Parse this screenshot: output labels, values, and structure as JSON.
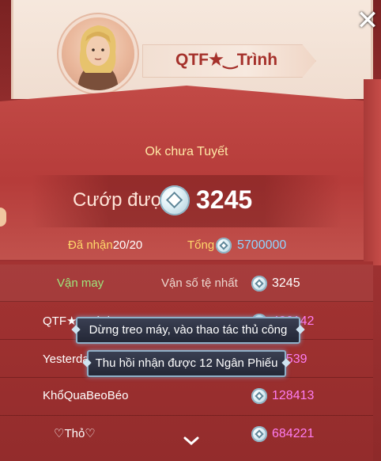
{
  "player": {
    "name": "QTF★‿Trình"
  },
  "message": "Ok chưa Tuyết",
  "loot": {
    "label": "Cướp được",
    "value": "3245"
  },
  "stats": {
    "received_label": "Đã nhận",
    "received_value": "20/20",
    "total_label": "Tổng",
    "total_value": "5700000"
  },
  "list": {
    "header": {
      "luck_label": "Vận may",
      "worst_label": "Vận số tệ nhất",
      "worst_value": "3245"
    },
    "rows": [
      {
        "name": "QTF★‿Trình",
        "value": "426142"
      },
      {
        "name": "Yesterday",
        "value": "77539"
      },
      {
        "name": "KhổQuaBeoBéo",
        "value": "128413"
      },
      {
        "name": "♡Thỏ♡",
        "value": "684221"
      }
    ]
  },
  "toasts": [
    "Dừng treo máy, vào thao tác thủ công",
    "Thu hồi nhận được 12 Ngân Phiếu"
  ],
  "icons": {
    "close": "close-icon",
    "coin": "silver-coin-icon",
    "expand": "chevron-down-icon"
  },
  "colors": {
    "accent_red": "#b63c3a",
    "gold_text": "#ffd76a",
    "luck_green": "#9ee67c",
    "value_pink": "#ff7cf2",
    "total_blue": "#8fd5ff"
  }
}
